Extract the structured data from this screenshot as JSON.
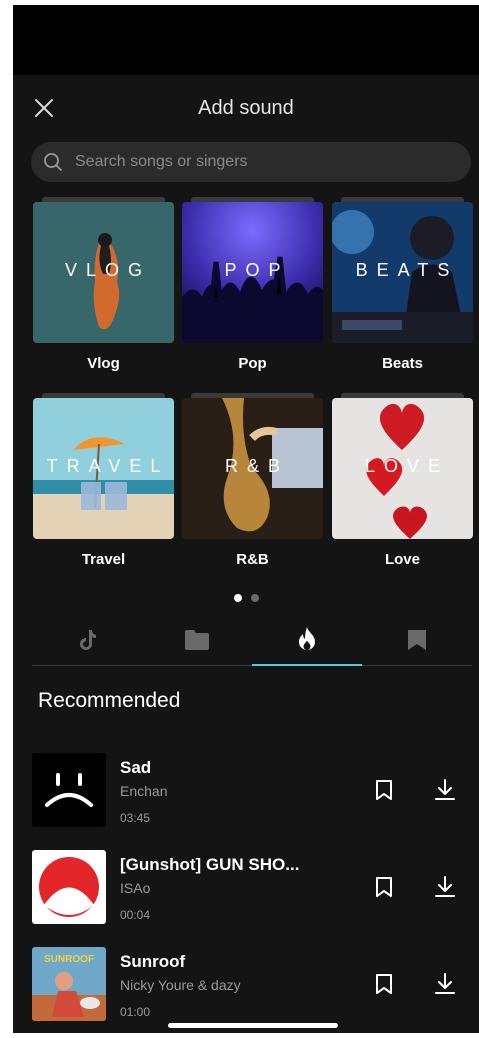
{
  "header": {
    "title": "Add sound"
  },
  "search": {
    "placeholder": "Search songs or singers"
  },
  "categories": [
    {
      "tile_text": "VLOG",
      "label": "Vlog"
    },
    {
      "tile_text": "POP",
      "label": "Pop"
    },
    {
      "tile_text": "BEATS",
      "label": "Beats"
    },
    {
      "tile_text": "TRAVEL",
      "label": "Travel"
    },
    {
      "tile_text": "R&B",
      "label": "R&B"
    },
    {
      "tile_text": "LOVE",
      "label": "Love"
    }
  ],
  "pager": {
    "active": 1,
    "count": 2
  },
  "tabs": [
    {
      "icon": "tiktok-icon",
      "active": false
    },
    {
      "icon": "folder-icon",
      "active": false
    },
    {
      "icon": "flame-icon",
      "active": true
    },
    {
      "icon": "bookmark-icon",
      "active": false
    }
  ],
  "section": {
    "title": "Recommended"
  },
  "songs": [
    {
      "title": "Sad",
      "artist": "Enchan",
      "duration": "03:45"
    },
    {
      "title": "[Gunshot] GUN SHO...",
      "artist": "ISAo",
      "duration": "00:04"
    },
    {
      "title": "Sunroof",
      "artist": "Nicky Youre & dazy",
      "duration": "01:00",
      "cover_text": "SUNROOF"
    }
  ],
  "colors": {
    "background": "#141414",
    "accent": "#4fd1cf",
    "text": "#ffffff",
    "muted": "#9a9a9a"
  }
}
